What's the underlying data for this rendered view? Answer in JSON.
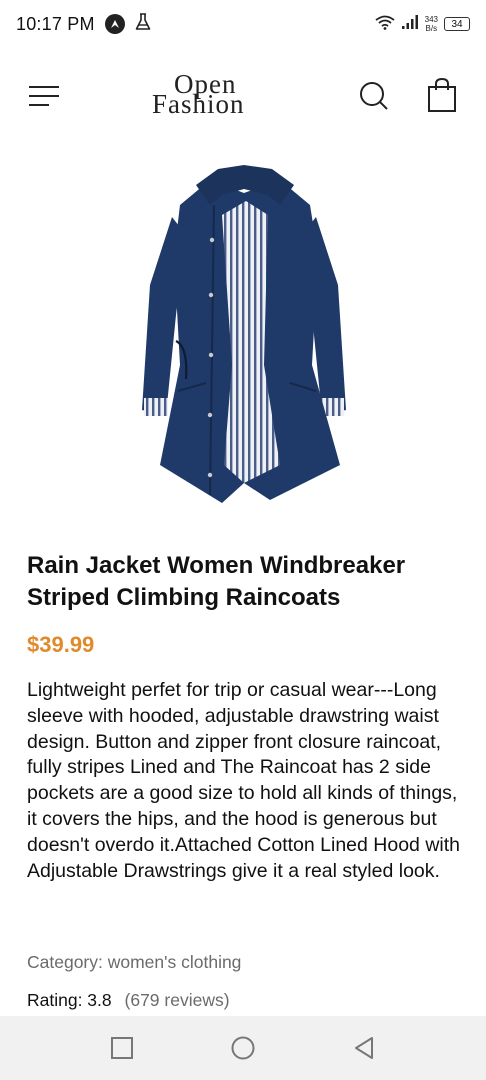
{
  "status_bar": {
    "time": "10:17 PM",
    "net_speed_value": "343",
    "net_speed_unit": "B/s",
    "battery": "34",
    "icons": [
      "nav-arrow-icon",
      "lab-flask-icon",
      "wifi-icon",
      "signal-icon",
      "battery-icon"
    ]
  },
  "header": {
    "brand_line1": "Open",
    "brand_line2": "Fashion",
    "icons": [
      "hamburger-menu-icon",
      "search-icon",
      "shopping-bag-icon"
    ]
  },
  "product": {
    "title": "Rain Jacket Women Windbreaker Striped Climbing Raincoats",
    "price": "$39.99",
    "description": "Lightweight perfet for trip or casual wear---Long sleeve with hooded, adjustable drawstring waist design. Button and zipper front closure raincoat, fully stripes Lined and The Raincoat has 2 side pockets are a good size to hold all kinds of things, it covers the hips, and the hood is generous but doesn't overdo it.Attached Cotton Lined Hood with Adjustable Drawstrings give it a real styled look.",
    "category": "Category: women's clothing",
    "rating": "Rating: 3.8",
    "reviews": "(679 reviews)"
  },
  "colors": {
    "accent_price": "#e08a2c",
    "muted_text": "#6b6b6b",
    "nav_bar_bg": "#f1f1f1",
    "jacket_navy": "#1f3a68"
  },
  "nav_bar": {
    "icons": [
      "recents-square-icon",
      "home-circle-icon",
      "back-triangle-icon"
    ]
  }
}
